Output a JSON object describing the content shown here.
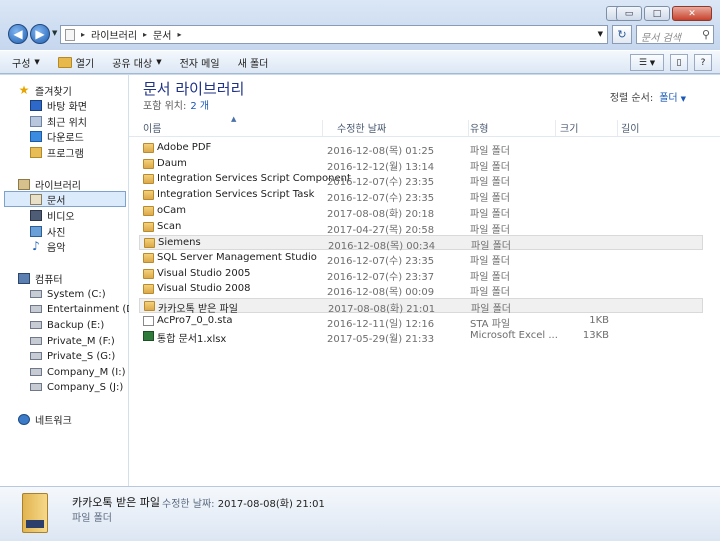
{
  "window": {
    "swap_icon": "⇔",
    "min_icon": "▭",
    "max_icon": "□",
    "close_icon": "✕"
  },
  "nav": {
    "back_icon": "◀",
    "forward_icon": "▶",
    "breadcrumbs": [
      "라이브러리",
      "문서"
    ],
    "search_placeholder": "문서 검색"
  },
  "toolbar": {
    "items": [
      "구성",
      "열기",
      "공유 대상",
      "전자 메일",
      "새 폴더"
    ]
  },
  "sidebar": {
    "favorites": "즐겨찾기",
    "fav_items": [
      "바탕 화면",
      "최근 위치",
      "다운로드",
      "프로그램"
    ],
    "libraries": "라이브러리",
    "lib_items": [
      "문서",
      "비디오",
      "사진",
      "음악"
    ],
    "computer": "컴퓨터",
    "drives": [
      "System (C:)",
      "Entertainment (D:)",
      "Backup (E:)",
      "Private_M (F:)",
      "Private_S (G:)",
      "Company_M (I:)",
      "Company_S (J:)"
    ],
    "network": "네트워크"
  },
  "main": {
    "title": "문서 라이브러리",
    "location_label": "포함 위치:",
    "location_value": "2 개",
    "sort_label": "정렬 순서:",
    "sort_value": "폴더",
    "columns": [
      "이름",
      "수정한 날짜",
      "유형",
      "크기",
      "길이"
    ],
    "rows": [
      {
        "name": "Adobe PDF",
        "date": "2016-12-08(목) 01:25",
        "type": "파일 폴더",
        "size": "",
        "kind": "folder"
      },
      {
        "name": "Daum",
        "date": "2016-12-12(월) 13:14",
        "type": "파일 폴더",
        "size": "",
        "kind": "folder"
      },
      {
        "name": "Integration Services Script Component",
        "date": "2016-12-07(수) 23:35",
        "type": "파일 폴더",
        "size": "",
        "kind": "folder"
      },
      {
        "name": "Integration Services Script Task",
        "date": "2016-12-07(수) 23:35",
        "type": "파일 폴더",
        "size": "",
        "kind": "folder"
      },
      {
        "name": "oCam",
        "date": "2017-08-08(화) 20:18",
        "type": "파일 폴더",
        "size": "",
        "kind": "folder"
      },
      {
        "name": "Scan",
        "date": "2017-04-27(목) 20:58",
        "type": "파일 폴더",
        "size": "",
        "kind": "folder"
      },
      {
        "name": "Siemens",
        "date": "2016-12-08(목) 00:34",
        "type": "파일 폴더",
        "size": "",
        "kind": "folder"
      },
      {
        "name": "SQL Server Management Studio",
        "date": "2016-12-07(수) 23:35",
        "type": "파일 폴더",
        "size": "",
        "kind": "folder"
      },
      {
        "name": "Visual Studio 2005",
        "date": "2016-12-07(수) 23:37",
        "type": "파일 폴더",
        "size": "",
        "kind": "folder"
      },
      {
        "name": "Visual Studio 2008",
        "date": "2016-12-08(목) 00:09",
        "type": "파일 폴더",
        "size": "",
        "kind": "folder"
      },
      {
        "name": "카카오톡 받은 파일",
        "date": "2017-08-08(화) 21:01",
        "type": "파일 폴더",
        "size": "",
        "kind": "folder"
      },
      {
        "name": "AcPro7_0_0.sta",
        "date": "2016-12-11(일) 12:16",
        "type": "STA 파일",
        "size": "1KB",
        "kind": "file"
      },
      {
        "name": "통합 문서1.xlsx",
        "date": "2017-05-29(월) 21:33",
        "type": "Microsoft Excel ...",
        "size": "13KB",
        "kind": "xlsx"
      }
    ]
  },
  "details": {
    "name": "카카오톡 받은 파일",
    "modified_label": "수정한 날짜:",
    "modified_value": "2017-08-08(화) 21:01",
    "type": "파일 폴더"
  }
}
